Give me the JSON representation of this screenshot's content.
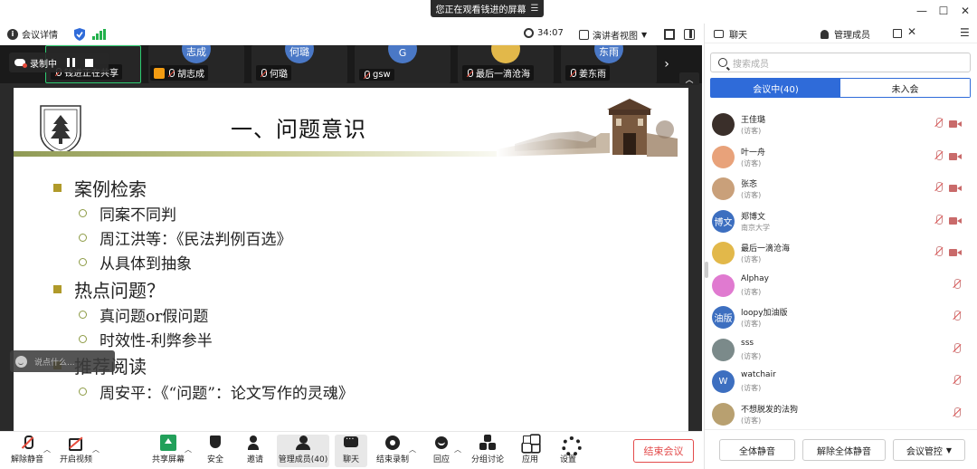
{
  "share_banner": {
    "text": "您正在观看钱进的屏幕"
  },
  "window": {
    "minimize": "—",
    "maximize": "☐",
    "close": "✕"
  },
  "infobar": {
    "meeting_details": "会议详情",
    "timer": "34:07",
    "view_mode": "演讲者视图"
  },
  "recording": {
    "label": "录制中"
  },
  "video_strip": [
    {
      "avatar": "",
      "name": "钱进正在共享",
      "self": true
    },
    {
      "avatar": "志成",
      "name": "胡志成"
    },
    {
      "avatar": "何璐",
      "name": "何璐"
    },
    {
      "avatar": "G",
      "name": "gsw"
    },
    {
      "avatar": "",
      "name": "最后一滴沧海"
    },
    {
      "avatar": "东雨",
      "name": "姜东雨"
    }
  ],
  "slide": {
    "title": "一、问题意识",
    "bullets": [
      {
        "text": "案例检索",
        "sub": [
          "同案不同判",
          "周江洪等：《民法判例百选》",
          "从具体到抽象"
        ]
      },
      {
        "text": "热点问题？",
        "sub": [
          "真问题or假问题",
          "时效性-利弊参半"
        ]
      },
      {
        "text": "推荐阅读",
        "sub": [
          "周安平：《“问题”：论文写作的灵魂》"
        ]
      }
    ]
  },
  "chat_float": {
    "placeholder": "说点什么..."
  },
  "toolbar": {
    "unmute": "解除静音",
    "start_video": "开启视频",
    "share_screen": "共享屏幕",
    "security": "安全",
    "invite": "邀请",
    "members": "管理成员(40)",
    "chat": "聊天",
    "end_record": "结束录制",
    "reaction": "回应",
    "breakout": "分组讨论",
    "apps": "应用",
    "settings": "设置",
    "end_meeting": "结束会议"
  },
  "panel": {
    "tab_chat": "聊天",
    "tab_members": "管理成员",
    "search_placeholder": "搜索成员",
    "in_meeting": "会议中(40)",
    "not_joined": "未入会",
    "members": [
      {
        "name": "王佳璐",
        "role": "(访客)",
        "avatar": "",
        "color": "#3a2f2a",
        "video": true
      },
      {
        "name": "叶一舟",
        "role": "(访客)",
        "avatar": "",
        "color": "#e8a27a",
        "video": true
      },
      {
        "name": "张忞",
        "role": "(访客)",
        "avatar": "",
        "color": "#c9a07a",
        "video": true
      },
      {
        "name": "郑博文",
        "role": "南京大学",
        "avatar": "博文",
        "color": "#3d6fc0",
        "video": true
      },
      {
        "name": "最后一滴沧海",
        "role": "(访客)",
        "avatar": "",
        "color": "#e2b84a",
        "video": true
      },
      {
        "name": "Alphay",
        "role": "(访客)",
        "avatar": "",
        "color": "#e07ad0",
        "video": false
      },
      {
        "name": "loopy加油版",
        "role": "(访客)",
        "avatar": "油版",
        "color": "#3d6fc0",
        "video": false
      },
      {
        "name": "sss",
        "role": "(访客)",
        "avatar": "",
        "color": "#7b8a8a",
        "video": false
      },
      {
        "name": "watchair",
        "role": "(访客)",
        "avatar": "W",
        "color": "#3d6fc0",
        "video": false
      },
      {
        "name": "不想脱发的法狗",
        "role": "(访客)",
        "avatar": "",
        "color": "#b8a070",
        "video": false
      }
    ],
    "mute_all": "全体静音",
    "unmute_all": "解除全体静音",
    "meeting_control": "会议管控"
  },
  "colors": {
    "accent": "#2f6bd9",
    "danger": "#e34b4b",
    "green": "#22a05a",
    "slide_bullet": "#b09a2a"
  }
}
